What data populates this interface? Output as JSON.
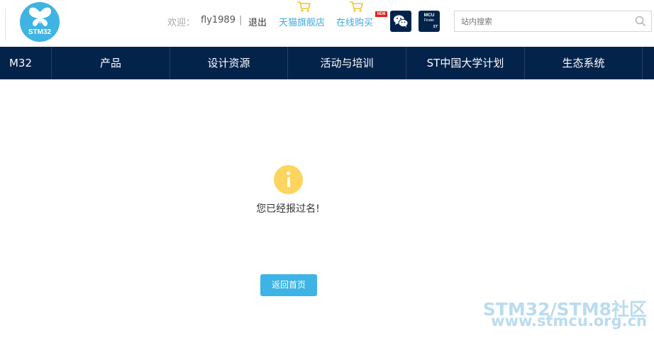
{
  "header": {
    "logo_text": "STM32",
    "welcome_label": "欢迎：",
    "username": "fly1989",
    "separator": "|",
    "logout_label": "退出",
    "tmall_label": "天猫旗舰店",
    "buy_label": "在线购买",
    "new_badge": "NEW",
    "mcu_finder": {
      "line1": "MCU",
      "line2": "Finder",
      "brand": "ST"
    },
    "search": {
      "placeholder": "站内搜索",
      "value": ""
    }
  },
  "nav": {
    "items": [
      {
        "label": "M32"
      },
      {
        "label": "产品"
      },
      {
        "label": "设计资源"
      },
      {
        "label": "活动与培训"
      },
      {
        "label": "ST中国大学计划"
      },
      {
        "label": "生态系统"
      }
    ]
  },
  "main": {
    "message": "您已经报过名!",
    "home_button_label": "返回首页"
  },
  "watermark": {
    "line1": "STM32/STM8社区",
    "line2": "www.stmcu.org.cn"
  },
  "colors": {
    "nav_bg": "#03234b",
    "accent": "#3eb4e6",
    "info_icon": "#fdd55e"
  }
}
